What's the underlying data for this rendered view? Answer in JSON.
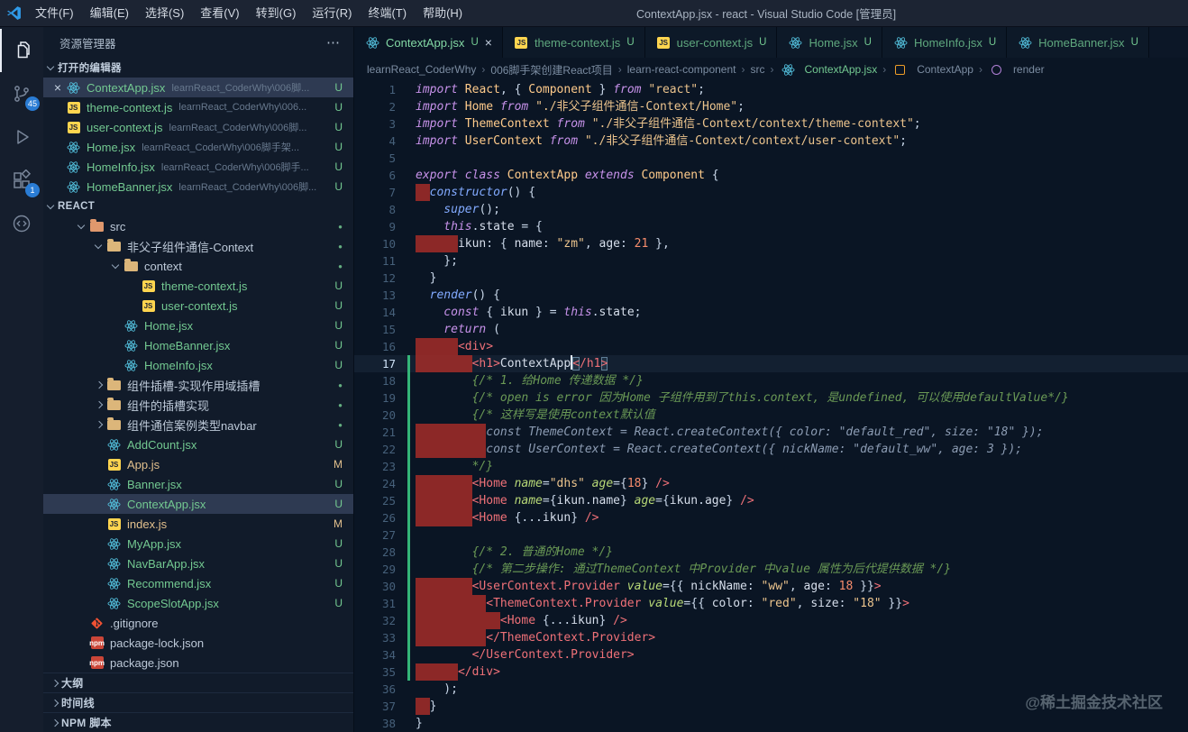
{
  "title_bar": {
    "menus": [
      "文件(F)",
      "编辑(E)",
      "选择(S)",
      "查看(V)",
      "转到(G)",
      "运行(R)",
      "终端(T)",
      "帮助(H)"
    ],
    "title": "ContextApp.jsx - react - Visual Studio Code [管理员]"
  },
  "activity_bar": {
    "source_control_badge": "45",
    "extensions_badge": "1"
  },
  "colors": {
    "untracked": "#73c991",
    "modified": "#e2c08d",
    "git_added": "#34b578",
    "indent_error": "rgba(173,45,40,0.8)",
    "accent_badge": "#2a7cd4"
  },
  "sidebar": {
    "title": "资源管理器",
    "open_editors": {
      "label": "打开的编辑器",
      "items": [
        {
          "label": "ContextApp.jsx",
          "path": "learnReact_CoderWhy\\006脚...",
          "status": "U",
          "icon": "react",
          "active": true
        },
        {
          "label": "theme-context.js",
          "path": "learnReact_CoderWhy\\006...",
          "status": "U",
          "icon": "js"
        },
        {
          "label": "user-context.js",
          "path": "learnReact_CoderWhy\\006脚...",
          "status": "U",
          "icon": "js"
        },
        {
          "label": "Home.jsx",
          "path": "learnReact_CoderWhy\\006脚手架...",
          "status": "U",
          "icon": "react"
        },
        {
          "label": "HomeInfo.jsx",
          "path": "learnReact_CoderWhy\\006脚手...",
          "status": "U",
          "icon": "react"
        },
        {
          "label": "HomeBanner.jsx",
          "path": "learnReact_CoderWhy\\006脚...",
          "status": "U",
          "icon": "react"
        }
      ]
    },
    "tree_label": "REACT",
    "tree": [
      {
        "lv": 1,
        "chev": "down",
        "icon": "folder-src",
        "label": "src",
        "color": "dim",
        "badge": "dot"
      },
      {
        "lv": 2,
        "chev": "down",
        "icon": "folder",
        "label": "非父子组件通信-Context",
        "color": "dim",
        "badge": "dot"
      },
      {
        "lv": 3,
        "chev": "down",
        "icon": "folder",
        "label": "context",
        "color": "dim",
        "badge": "dot"
      },
      {
        "lv": 4,
        "icon": "js",
        "label": "theme-context.js",
        "color": "green",
        "badge": "U"
      },
      {
        "lv": 4,
        "icon": "js",
        "label": "user-context.js",
        "color": "green",
        "badge": "U"
      },
      {
        "lv": 3,
        "icon": "react",
        "label": "Home.jsx",
        "color": "green",
        "badge": "U"
      },
      {
        "lv": 3,
        "icon": "react",
        "label": "HomeBanner.jsx",
        "color": "green",
        "badge": "U"
      },
      {
        "lv": 3,
        "icon": "react",
        "label": "HomeInfo.jsx",
        "color": "green",
        "badge": "U"
      },
      {
        "lv": 2,
        "chev": "right",
        "icon": "folder",
        "label": "组件插槽-实现作用域插槽",
        "color": "dim",
        "badge": "dot"
      },
      {
        "lv": 2,
        "chev": "right",
        "icon": "folder",
        "label": "组件的插槽实现",
        "color": "dim",
        "badge": "dot"
      },
      {
        "lv": 2,
        "chev": "right",
        "icon": "folder",
        "label": "组件通信案例类型navbar",
        "color": "dim",
        "badge": "dot"
      },
      {
        "lv": 2,
        "icon": "react",
        "label": "AddCount.jsx",
        "color": "green",
        "badge": "U"
      },
      {
        "lv": 2,
        "icon": "js",
        "label": "App.js",
        "color": "orange",
        "badge": "M"
      },
      {
        "lv": 2,
        "icon": "react",
        "label": "Banner.jsx",
        "color": "green",
        "badge": "U"
      },
      {
        "lv": 2,
        "icon": "react",
        "label": "ContextApp.jsx",
        "color": "green",
        "badge": "U",
        "selected": true
      },
      {
        "lv": 2,
        "icon": "js",
        "label": "index.js",
        "color": "orange",
        "badge": "M"
      },
      {
        "lv": 2,
        "icon": "react",
        "label": "MyApp.jsx",
        "color": "green",
        "badge": "U"
      },
      {
        "lv": 2,
        "icon": "react",
        "label": "NavBarApp.jsx",
        "color": "green",
        "badge": "U"
      },
      {
        "lv": 2,
        "icon": "react",
        "label": "Recommend.jsx",
        "color": "green",
        "badge": "U"
      },
      {
        "lv": 2,
        "icon": "react",
        "label": "ScopeSlotApp.jsx",
        "color": "green",
        "badge": "U"
      },
      {
        "lv": 1,
        "icon": "git",
        "label": ".gitignore",
        "color": "dim",
        "badge": ""
      },
      {
        "lv": 1,
        "icon": "npm",
        "label": "package-lock.json",
        "color": "dim",
        "badge": ""
      },
      {
        "lv": 1,
        "icon": "npm",
        "label": "package.json",
        "color": "dim",
        "badge": ""
      }
    ],
    "bottom_sections": [
      "大纲",
      "时间线",
      "NPM 脚本"
    ]
  },
  "tabs": [
    {
      "label": "ContextApp.jsx",
      "status": "U",
      "icon": "react",
      "active": true
    },
    {
      "label": "theme-context.js",
      "status": "U",
      "icon": "js"
    },
    {
      "label": "user-context.js",
      "status": "U",
      "icon": "js"
    },
    {
      "label": "Home.jsx",
      "status": "U",
      "icon": "react"
    },
    {
      "label": "HomeInfo.jsx",
      "status": "U",
      "icon": "react"
    },
    {
      "label": "HomeBanner.jsx",
      "status": "U",
      "icon": "react"
    }
  ],
  "breadcrumbs": [
    {
      "label": "learnReact_CoderWhy"
    },
    {
      "label": "006脚手架创建React项目"
    },
    {
      "label": "learn-react-component"
    },
    {
      "label": "src"
    },
    {
      "label": "ContextApp.jsx",
      "icon": "react",
      "green": true
    },
    {
      "label": "ContextApp",
      "icon": "sym-class"
    },
    {
      "label": "render",
      "icon": "sym-method"
    }
  ],
  "editor": {
    "lines": [
      {
        "n": 1,
        "ind": 0,
        "tok": [
          [
            "k",
            "import "
          ],
          [
            "c",
            "React"
          ],
          [
            "p",
            ", { "
          ],
          [
            "c",
            "Component"
          ],
          [
            "p",
            " } "
          ],
          [
            "k",
            "from "
          ],
          [
            "s",
            "\"react\""
          ],
          [
            "p",
            ";"
          ]
        ]
      },
      {
        "n": 2,
        "ind": 0,
        "tok": [
          [
            "k",
            "import "
          ],
          [
            "c",
            "Home"
          ],
          [
            "k",
            " from "
          ],
          [
            "s",
            "\"./非父子组件通信-Context/Home\""
          ],
          [
            "p",
            ";"
          ]
        ]
      },
      {
        "n": 3,
        "ind": 0,
        "tok": [
          [
            "k",
            "import "
          ],
          [
            "c",
            "ThemeContext"
          ],
          [
            "k",
            " from "
          ],
          [
            "s",
            "\"./非父子组件通信-Context/context/theme-context\""
          ],
          [
            "p",
            ";"
          ]
        ]
      },
      {
        "n": 4,
        "ind": 0,
        "tok": [
          [
            "k",
            "import "
          ],
          [
            "c",
            "UserContext"
          ],
          [
            "k",
            " from "
          ],
          [
            "s",
            "\"./非父子组件通信-Context/context/user-context\""
          ],
          [
            "p",
            ";"
          ]
        ]
      },
      {
        "n": 5,
        "ind": 0,
        "tok": []
      },
      {
        "n": 6,
        "ind": 0,
        "tok": [
          [
            "k",
            "export class "
          ],
          [
            "c",
            "ContextApp"
          ],
          [
            "k",
            " extends "
          ],
          [
            "c",
            "Component"
          ],
          [
            "p",
            " {"
          ]
        ]
      },
      {
        "n": 7,
        "ind": 2,
        "r": 1,
        "tok": [
          [
            "f",
            "constructor"
          ],
          [
            "p",
            "() {"
          ]
        ]
      },
      {
        "n": 8,
        "ind": 4,
        "tok": [
          [
            "f",
            "super"
          ],
          [
            "p",
            "();"
          ]
        ]
      },
      {
        "n": 9,
        "ind": 4,
        "tok": [
          [
            "k",
            "this"
          ],
          [
            "p",
            "."
          ],
          [
            "i",
            "state"
          ],
          [
            "p",
            " = {"
          ]
        ]
      },
      {
        "n": 10,
        "ind": 6,
        "r": 1,
        "tok": [
          [
            "i",
            "ikun"
          ],
          [
            "p",
            ": { "
          ],
          [
            "i",
            "name"
          ],
          [
            "p",
            ": "
          ],
          [
            "s",
            "\"zm\""
          ],
          [
            "p",
            ", "
          ],
          [
            "i",
            "age"
          ],
          [
            "p",
            ": "
          ],
          [
            "n",
            "21"
          ],
          [
            "p",
            " },"
          ]
        ]
      },
      {
        "n": 11,
        "ind": 4,
        "tok": [
          [
            "p",
            "};"
          ]
        ]
      },
      {
        "n": 12,
        "ind": 2,
        "tok": [
          [
            "p",
            "}"
          ]
        ]
      },
      {
        "n": 13,
        "ind": 2,
        "tok": [
          [
            "f",
            "render"
          ],
          [
            "p",
            "() {"
          ]
        ]
      },
      {
        "n": 14,
        "ind": 4,
        "tok": [
          [
            "k",
            "const"
          ],
          [
            "p",
            " { "
          ],
          [
            "i",
            "ikun"
          ],
          [
            "p",
            " } = "
          ],
          [
            "k",
            "this"
          ],
          [
            "p",
            "."
          ],
          [
            "i",
            "state"
          ],
          [
            "p",
            ";"
          ]
        ]
      },
      {
        "n": 15,
        "ind": 4,
        "tok": [
          [
            "k",
            "return"
          ],
          [
            "p",
            " ("
          ]
        ]
      },
      {
        "n": 16,
        "ind": 6,
        "r": 1,
        "tok": [
          [
            "t",
            "<div>"
          ]
        ]
      },
      {
        "n": 17,
        "ind": 8,
        "r": 1,
        "g": 1,
        "c": 1,
        "tok": [
          [
            "t",
            "<h1>"
          ],
          [
            "i",
            "ContextApp"
          ],
          [
            "cur",
            ""
          ],
          [
            "t bm",
            "<"
          ],
          [
            "t",
            "/h1"
          ],
          [
            "t bm",
            ">"
          ]
        ]
      },
      {
        "n": 18,
        "ind": 8,
        "g": 1,
        "tok": [
          [
            "m",
            "{/* 1. 给Home 传递数据 */}"
          ]
        ]
      },
      {
        "n": 19,
        "ind": 8,
        "g": 1,
        "tok": [
          [
            "m",
            "{/* open is error 因为Home 子组件用到了this.context, 是undefined, 可以使用defaultValue*/}"
          ]
        ]
      },
      {
        "n": 20,
        "ind": 8,
        "g": 1,
        "tok": [
          [
            "m",
            "{/* 这样写是使用context默认值"
          ]
        ]
      },
      {
        "n": 21,
        "ind": 10,
        "r": 1,
        "g": 1,
        "tok": [
          [
            "m2",
            "const ThemeContext = React.createContext({ color: \"default_red\", size: \"18\" });"
          ]
        ]
      },
      {
        "n": 22,
        "ind": 10,
        "r": 1,
        "g": 1,
        "tok": [
          [
            "m2",
            "const UserContext = React.createContext({ nickName: \"default_ww\", age: 3 });"
          ]
        ]
      },
      {
        "n": 23,
        "ind": 8,
        "g": 1,
        "tok": [
          [
            "m",
            "*/}"
          ]
        ]
      },
      {
        "n": 24,
        "ind": 8,
        "r": 1,
        "g": 1,
        "tok": [
          [
            "t",
            "<Home"
          ],
          [
            "a",
            " name"
          ],
          [
            "p",
            "="
          ],
          [
            "s",
            "\"dhs\""
          ],
          [
            "a",
            " age"
          ],
          [
            "p",
            "={"
          ],
          [
            "n",
            "18"
          ],
          [
            "p",
            "}"
          ],
          [
            "t",
            " />"
          ]
        ]
      },
      {
        "n": 25,
        "ind": 8,
        "r": 1,
        "g": 1,
        "tok": [
          [
            "t",
            "<Home"
          ],
          [
            "a",
            " name"
          ],
          [
            "p",
            "={"
          ],
          [
            "i",
            "ikun"
          ],
          [
            "p",
            "."
          ],
          [
            "i",
            "name"
          ],
          [
            "p",
            "}"
          ],
          [
            "a",
            " age"
          ],
          [
            "p",
            "={"
          ],
          [
            "i",
            "ikun"
          ],
          [
            "p",
            "."
          ],
          [
            "i",
            "age"
          ],
          [
            "p",
            "}"
          ],
          [
            "t",
            " />"
          ]
        ]
      },
      {
        "n": 26,
        "ind": 8,
        "r": 1,
        "g": 1,
        "tok": [
          [
            "t",
            "<Home"
          ],
          [
            "p",
            " {..."
          ],
          [
            "i",
            "ikun"
          ],
          [
            "p",
            "}"
          ],
          [
            "t",
            " />"
          ]
        ]
      },
      {
        "n": 27,
        "ind": 0,
        "g": 1,
        "tok": []
      },
      {
        "n": 28,
        "ind": 8,
        "g": 1,
        "tok": [
          [
            "m",
            "{/* 2. 普通的Home */}"
          ]
        ]
      },
      {
        "n": 29,
        "ind": 8,
        "g": 1,
        "tok": [
          [
            "m",
            "{/* 第二步操作: 通过ThemeContext 中Provider 中value 属性为后代提供数据 */}"
          ]
        ]
      },
      {
        "n": 30,
        "ind": 8,
        "r": 1,
        "g": 1,
        "tok": [
          [
            "t",
            "<UserContext.Provider"
          ],
          [
            "a",
            " value"
          ],
          [
            "p",
            "={{ "
          ],
          [
            "i",
            "nickName"
          ],
          [
            "p",
            ": "
          ],
          [
            "s",
            "\"ww\""
          ],
          [
            "p",
            ", "
          ],
          [
            "i",
            "age"
          ],
          [
            "p",
            ": "
          ],
          [
            "n",
            "18"
          ],
          [
            "p",
            " }}"
          ],
          [
            "t",
            ">"
          ]
        ]
      },
      {
        "n": 31,
        "ind": 10,
        "r": 1,
        "g": 1,
        "tok": [
          [
            "t",
            "<ThemeContext.Provider"
          ],
          [
            "a",
            " value"
          ],
          [
            "p",
            "={{ "
          ],
          [
            "i",
            "color"
          ],
          [
            "p",
            ": "
          ],
          [
            "s",
            "\"red\""
          ],
          [
            "p",
            ", "
          ],
          [
            "i",
            "size"
          ],
          [
            "p",
            ": "
          ],
          [
            "s",
            "\"18\""
          ],
          [
            "p",
            " }}"
          ],
          [
            "t",
            ">"
          ]
        ]
      },
      {
        "n": 32,
        "ind": 12,
        "r": 1,
        "g": 1,
        "tok": [
          [
            "t",
            "<Home"
          ],
          [
            "p",
            " {..."
          ],
          [
            "i",
            "ikun"
          ],
          [
            "p",
            "}"
          ],
          [
            "t",
            " />"
          ]
        ]
      },
      {
        "n": 33,
        "ind": 10,
        "r": 1,
        "g": 1,
        "tok": [
          [
            "t",
            "</ThemeContext.Provider>"
          ]
        ]
      },
      {
        "n": 34,
        "ind": 8,
        "g": 1,
        "tok": [
          [
            "t",
            "</UserContext.Provider>"
          ]
        ]
      },
      {
        "n": 35,
        "ind": 6,
        "r": 1,
        "g": 1,
        "tok": [
          [
            "t",
            "</div>"
          ]
        ]
      },
      {
        "n": 36,
        "ind": 4,
        "tok": [
          [
            "p",
            ");"
          ]
        ]
      },
      {
        "n": 37,
        "ind": 2,
        "r": 1,
        "tok": [
          [
            "p",
            "}"
          ]
        ]
      },
      {
        "n": 38,
        "ind": 0,
        "tok": [
          [
            "p",
            "}"
          ]
        ]
      }
    ]
  },
  "watermark": "@稀土掘金技术社区"
}
